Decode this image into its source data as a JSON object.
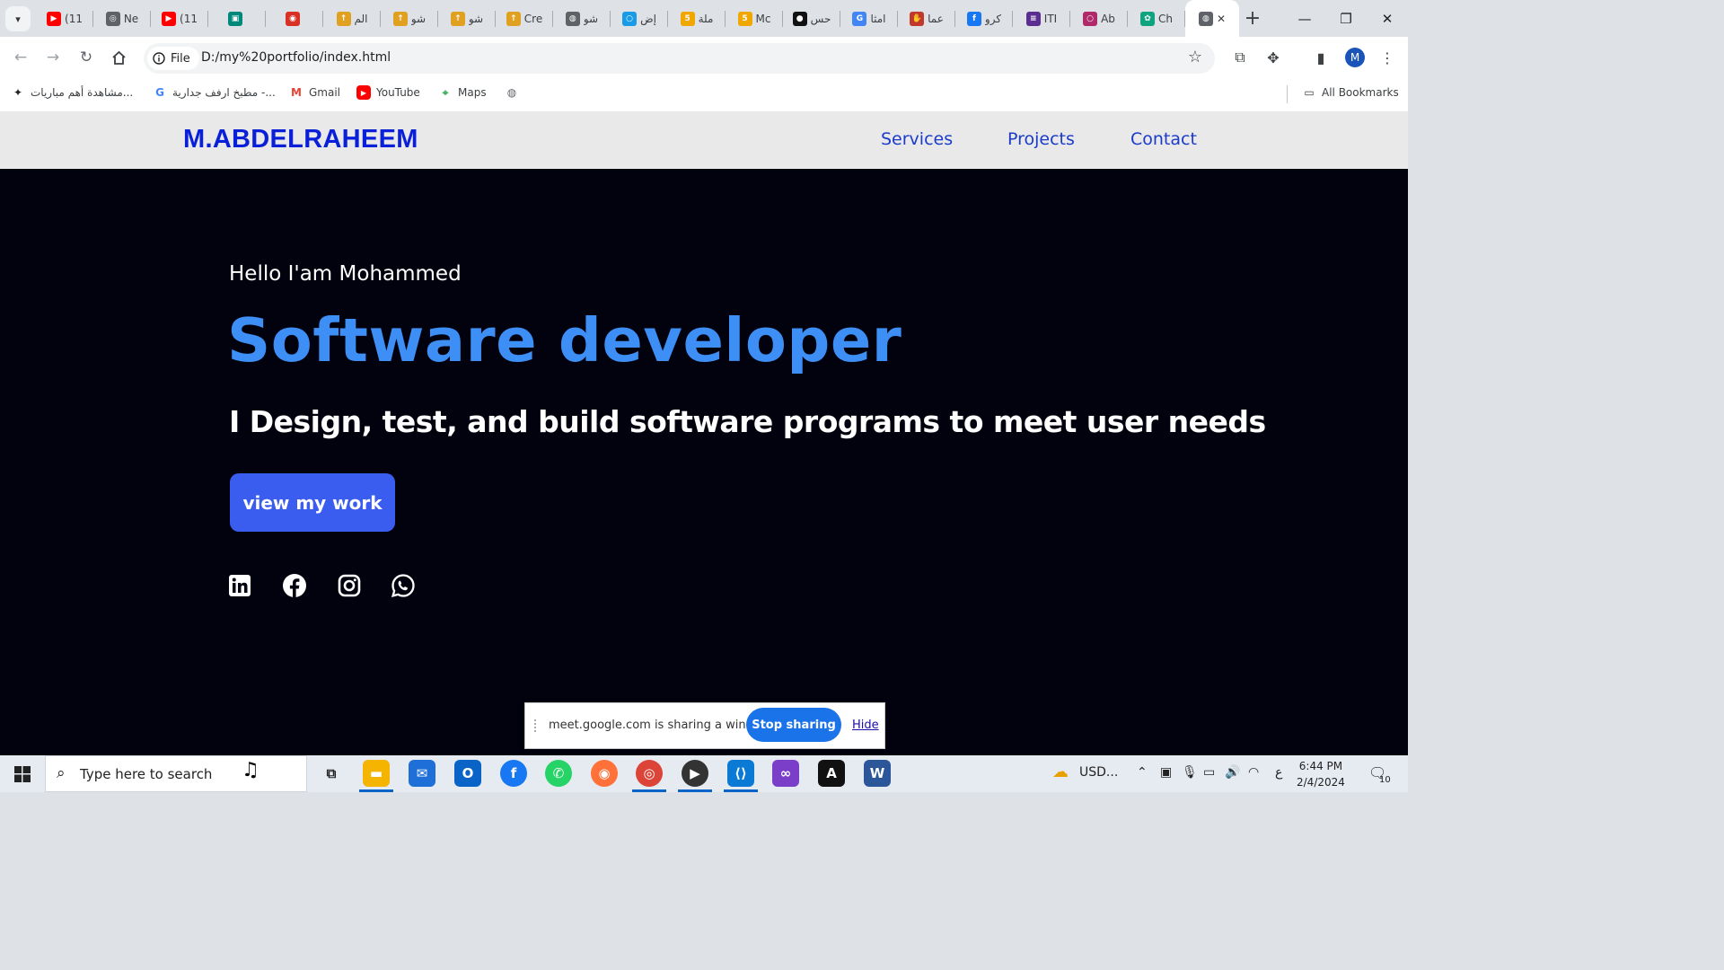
{
  "browser": {
    "tabs": [
      {
        "icon": "youtube-icon",
        "color": "#ff0000",
        "title": "(11"
      },
      {
        "icon": "chrome-icon",
        "color": "#5f6368",
        "title": "Ne"
      },
      {
        "icon": "youtube-icon",
        "color": "#ff0000",
        "title": "(11"
      },
      {
        "icon": "meet-icon",
        "color": "#00897b",
        "title": ""
      },
      {
        "icon": "record-icon",
        "color": "#d93025",
        "title": ""
      },
      {
        "icon": "mostaql-icon",
        "color": "#e0a020",
        "title": "الم"
      },
      {
        "icon": "mostaql-icon",
        "color": "#e0a020",
        "title": "شو"
      },
      {
        "icon": "mostaql-icon",
        "color": "#e0a020",
        "title": "شو"
      },
      {
        "icon": "mostaql-icon",
        "color": "#e0a020",
        "title": "Cre"
      },
      {
        "icon": "globe-icon",
        "color": "#5f6368",
        "title": "شو"
      },
      {
        "icon": "circle-icon",
        "color": "#1a9be8",
        "title": "إض"
      },
      {
        "icon": "five-icon",
        "color": "#f2a600",
        "title": "ملة"
      },
      {
        "icon": "five-icon",
        "color": "#f2a600",
        "title": "Mc"
      },
      {
        "icon": "dot-icon",
        "color": "#111111",
        "title": "حس"
      },
      {
        "icon": "google-icon",
        "color": "#4285f4",
        "title": "امثا"
      },
      {
        "icon": "hand-icon",
        "color": "#c0392b",
        "title": "عما"
      },
      {
        "icon": "facebook-icon",
        "color": "#1877f2",
        "title": "كرو"
      },
      {
        "icon": "list-icon",
        "color": "#5b2d90",
        "title": "ITI"
      },
      {
        "icon": "circle-icon",
        "color": "#b02a6a",
        "title": "Ab"
      },
      {
        "icon": "chatgpt-icon",
        "color": "#10a37f",
        "title": "Ch"
      }
    ],
    "active_tab_close": "✕",
    "new_tab": "+",
    "window_controls": {
      "minimize": "—",
      "restore": "❐",
      "close": "✕"
    },
    "address": {
      "scheme_label": "File",
      "url": "D:/my%20portfolio/index.html"
    },
    "profile_initial": "M",
    "bookmarks": [
      {
        "icon": "tool-icon",
        "label": "مشاهدة أهم مباريات..."
      },
      {
        "icon": "google-icon",
        "label": "مطبخ ارفف جدارية -..."
      },
      {
        "icon": "gmail-icon",
        "label": "Gmail"
      },
      {
        "icon": "youtube-icon",
        "label": "YouTube"
      },
      {
        "icon": "maps-icon",
        "label": "Maps"
      },
      {
        "icon": "globe-icon",
        "label": ""
      }
    ],
    "all_bookmarks": "All Bookmarks"
  },
  "site": {
    "logo": "M.ABDELRAHEEM",
    "nav": [
      "Services",
      "Projects",
      "Contact"
    ],
    "hero": {
      "greeting": "Hello I'am Mohammed",
      "role": "Software developer",
      "tagline": "I Design, test, and build software programs to meet user needs",
      "cta": "view my work"
    },
    "social": [
      "linkedin-icon",
      "facebook-icon",
      "instagram-icon",
      "whatsapp-icon"
    ]
  },
  "share_bar": {
    "message": "meet.google.com is sharing a window.",
    "stop": "Stop sharing",
    "hide": "Hide"
  },
  "taskbar": {
    "search_placeholder": "Type here to search",
    "tray_weather": "USD...",
    "lang": "ع",
    "time": "6:44 PM",
    "date": "2/4/2024",
    "notifications": "10"
  },
  "colors": {
    "accent": "#3d8ff5",
    "logo": "#0a1fd8",
    "cta": "#3a5df0",
    "hero_bg": "#02020f"
  }
}
